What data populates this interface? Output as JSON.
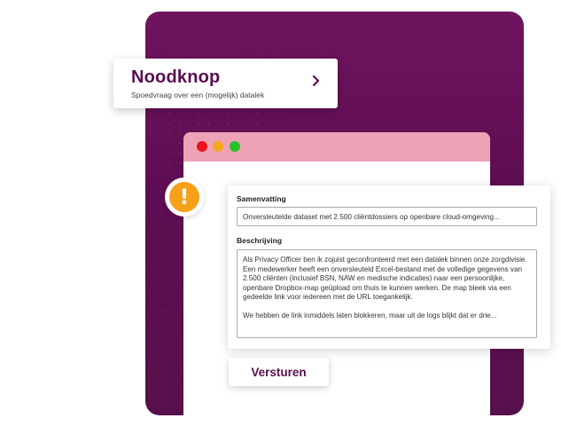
{
  "header": {
    "title": "Noodknop",
    "subtitle": "Spoedvraag over een (mogelijk) datalek"
  },
  "icons": {
    "chevron": "chevron-right-icon",
    "alert": "exclamation-icon",
    "alert_glyph": "!"
  },
  "browser": {
    "dots": [
      "red",
      "yellow",
      "green"
    ]
  },
  "form": {
    "summary_label": "Samenvatting",
    "summary_value": "Onversleutelde dataset met 2.500 cliëntdossiers op openbare cloud-omgeving...",
    "description_label": "Beschrijving",
    "description_paragraph_1": "Als Privacy Officer ben ik zojuist geconfronteerd met een datalek binnen onze zorgdivisie. Een medewerker heeft een onversleuteld Excel-bestand met de volledige gegevens van 2.500 cliënten (inclusief BSN, NAW en medische indicaties) naar een persoonlijke, openbare Dropbox-map geüpload om thuis te kunnen werken. De map bleek via een gedeelde link voor iedereen met de URL toegankelijk.",
    "description_paragraph_2": "We hebben de link inmiddels laten blokkeren, maar uit de logs blijkt dat er drie..."
  },
  "submit": {
    "label": "Versturen"
  },
  "colors": {
    "brand_purple": "#5a0e4f",
    "panel_purple": "#6a125b",
    "browser_bar": "#eea2b6",
    "alert_orange": "#f6a01a",
    "dot_red": "#e8141b",
    "dot_yellow": "#f5a71c",
    "dot_green": "#27c22b"
  }
}
